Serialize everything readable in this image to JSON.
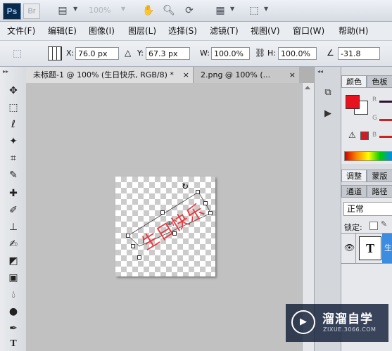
{
  "appbar": {
    "ps_logo": "Ps",
    "br_logo": "Br",
    "zoom": "100%"
  },
  "menu": [
    "文件(F)",
    "编辑(E)",
    "图像(I)",
    "图层(L)",
    "选择(S)",
    "滤镜(T)",
    "视图(V)",
    "窗口(W)",
    "帮助(H)"
  ],
  "options": {
    "x_label": "X:",
    "x_value": "76.0 px",
    "y_label": "Y:",
    "y_value": "67.3 px",
    "w_label": "W:",
    "w_value": "100.0%",
    "h_label": "H:",
    "h_value": "100.0%",
    "angle_value": "-31.8"
  },
  "tabs": [
    {
      "label": "未标题-1 @ 100% (生日快乐, RGB/8) *",
      "close": "×"
    },
    {
      "label": "2.png @ 100% (...",
      "close": "×"
    }
  ],
  "canvas": {
    "text": "生日快乐",
    "text_color": "#e8383d"
  },
  "panels": {
    "color_tabs": [
      "颜色",
      "色板"
    ],
    "channel_letters": [
      "R",
      "G",
      "B"
    ],
    "adjust_tabs": [
      "调整",
      "蒙版"
    ],
    "layer_tabs": [
      "通道",
      "路径"
    ],
    "blend_mode": "正常",
    "lock_label": "锁定:",
    "layer_thumb": "T",
    "layer_name": "生"
  },
  "colors": {
    "foreground": "#e8121e",
    "background": "#ffffff",
    "selection": "#3c8ce0"
  },
  "watermark": {
    "title": "溜溜自学",
    "url": "ZIXUE.3066.COM"
  }
}
